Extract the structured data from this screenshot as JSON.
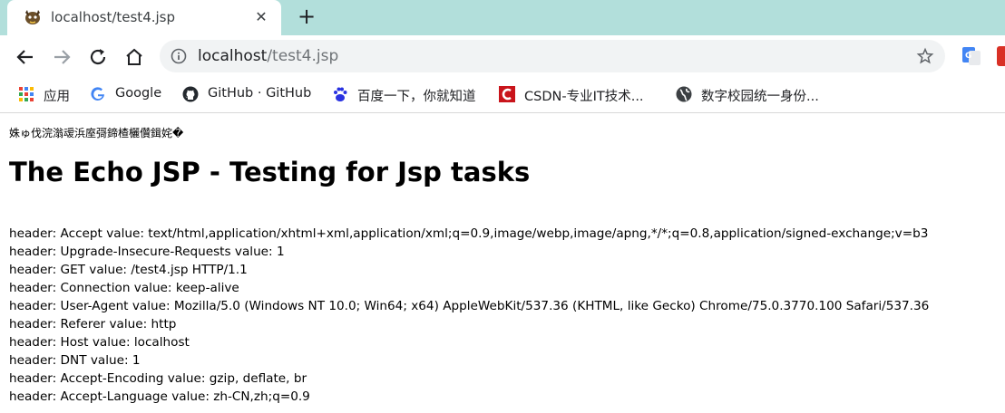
{
  "tab": {
    "title": "localhost/test4.jsp",
    "close": "✕",
    "new_tab": "+"
  },
  "omnibox": {
    "host": "localhost",
    "path": "/test4.jsp"
  },
  "bookmarks": [
    {
      "label": "应用",
      "icon": "apps-grid-icon"
    },
    {
      "label": "Google",
      "icon": "google-icon"
    },
    {
      "label": "GitHub · GitHub",
      "icon": "github-icon"
    },
    {
      "label": "百度一下，你就知道",
      "icon": "baidu-paw-icon"
    },
    {
      "label": "CSDN-专业IT技术...",
      "icon": "csdn-icon"
    },
    {
      "label": "数字校园统一身份...",
      "icon": "globe-icon"
    }
  ],
  "page": {
    "garbled_line": "姝ゅ伐浣滃叆浜庢彁鍗楂欐儹鍓姹�",
    "heading": "The Echo JSP - Testing for Jsp tasks",
    "headers": [
      "header: Accept value: text/html,application/xhtml+xml,application/xml;q=0.9,image/webp,image/apng,*/*;q=0.8,application/signed-exchange;v=b3",
      "header: Upgrade-Insecure-Requests value: 1",
      "header: GET value: /test4.jsp HTTP/1.1",
      "header: Connection value: keep-alive",
      "header: User-Agent value: Mozilla/5.0 (Windows NT 10.0; Win64; x64) AppleWebKit/537.36 (KHTML, like Gecko) Chrome/75.0.3770.100 Safari/537.36",
      "header: Referer value: http",
      "header: Host value: localhost",
      "header: DNT value: 1",
      "header: Accept-Encoding value: gzip, deflate, br",
      "header: Accept-Language value: zh-CN,zh;q=0.9"
    ]
  },
  "colors": {
    "tabstrip": "#b2dfdb",
    "omnibox": "#f1f3f4",
    "url_path": "#6f7377"
  }
}
